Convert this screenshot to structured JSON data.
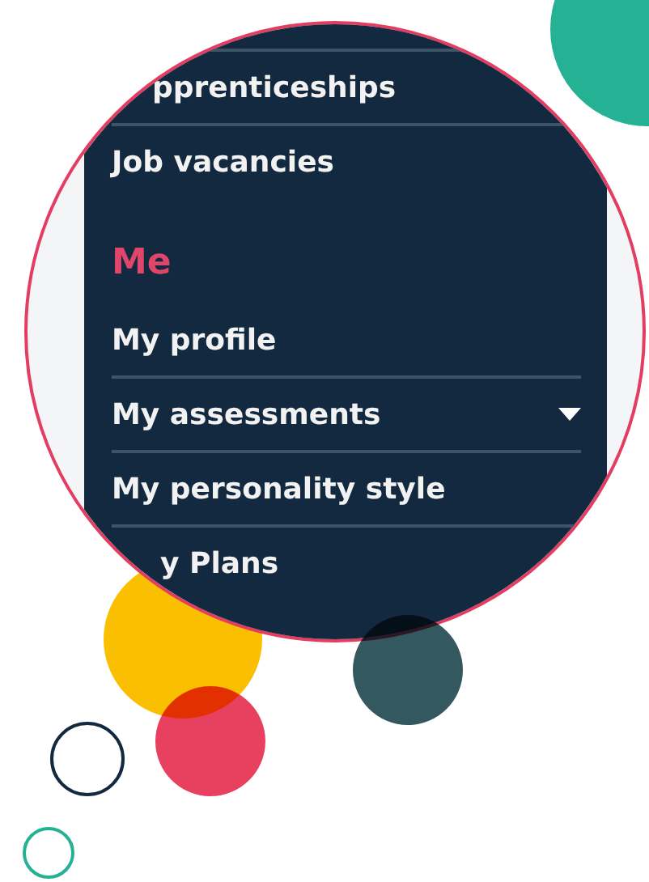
{
  "menu": {
    "items": [
      {
        "kind": "link",
        "label": "pprenticeships"
      },
      {
        "kind": "link",
        "label": "Job vacancies"
      },
      {
        "kind": "header",
        "label": "Me"
      },
      {
        "kind": "link",
        "label": "My profile"
      },
      {
        "kind": "dropdown",
        "label": "My assessments"
      },
      {
        "kind": "link",
        "label": "My personality style"
      },
      {
        "kind": "link",
        "label": "y Plans"
      }
    ]
  }
}
